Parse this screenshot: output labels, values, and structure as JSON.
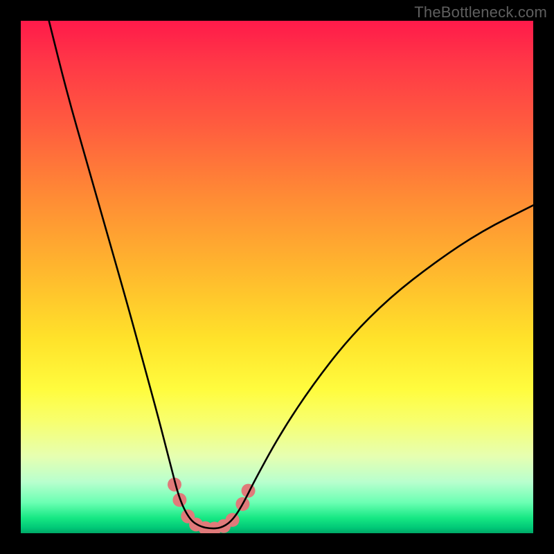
{
  "watermark": "TheBottleneck.com",
  "chart_data": {
    "type": "line",
    "title": "",
    "xlabel": "",
    "ylabel": "",
    "xlim": [
      0,
      100
    ],
    "ylim": [
      0,
      100
    ],
    "gradient_stops": [
      {
        "pct": 0,
        "color": "#ff1a4a"
      },
      {
        "pct": 8,
        "color": "#ff3747"
      },
      {
        "pct": 20,
        "color": "#ff5b3f"
      },
      {
        "pct": 34,
        "color": "#ff8a35"
      },
      {
        "pct": 48,
        "color": "#ffb52e"
      },
      {
        "pct": 62,
        "color": "#ffe22a"
      },
      {
        "pct": 72,
        "color": "#fffc3e"
      },
      {
        "pct": 78,
        "color": "#f8ff6d"
      },
      {
        "pct": 85,
        "color": "#e6ffb1"
      },
      {
        "pct": 90,
        "color": "#b8ffce"
      },
      {
        "pct": 94,
        "color": "#6bffb3"
      },
      {
        "pct": 97,
        "color": "#17e884"
      },
      {
        "pct": 99,
        "color": "#00c776"
      },
      {
        "pct": 100,
        "color": "#00a866"
      }
    ],
    "series": [
      {
        "name": "bottleneck-curve",
        "color": "#000000",
        "points": [
          {
            "x": 5.5,
            "y": 100
          },
          {
            "x": 9,
            "y": 86
          },
          {
            "x": 13,
            "y": 72
          },
          {
            "x": 17,
            "y": 58
          },
          {
            "x": 21,
            "y": 44
          },
          {
            "x": 24,
            "y": 33
          },
          {
            "x": 27,
            "y": 22
          },
          {
            "x": 29.3,
            "y": 13
          },
          {
            "x": 31,
            "y": 6.5
          },
          {
            "x": 33,
            "y": 2.6
          },
          {
            "x": 35,
            "y": 1.3
          },
          {
            "x": 37,
            "y": 0.9
          },
          {
            "x": 39,
            "y": 1.0
          },
          {
            "x": 41,
            "y": 2.2
          },
          {
            "x": 43,
            "y": 5.0
          },
          {
            "x": 46,
            "y": 11
          },
          {
            "x": 51,
            "y": 20
          },
          {
            "x": 57,
            "y": 29
          },
          {
            "x": 64,
            "y": 38
          },
          {
            "x": 72,
            "y": 46
          },
          {
            "x": 81,
            "y": 53
          },
          {
            "x": 90,
            "y": 59
          },
          {
            "x": 100,
            "y": 64
          }
        ]
      }
    ],
    "markers": {
      "color": "#e07a7a",
      "radius_px": 10,
      "points": [
        {
          "x": 30.0,
          "y": 9.5
        },
        {
          "x": 31.0,
          "y": 6.5
        },
        {
          "x": 32.6,
          "y": 3.3
        },
        {
          "x": 34.2,
          "y": 1.7
        },
        {
          "x": 36.0,
          "y": 1.0
        },
        {
          "x": 37.8,
          "y": 0.9
        },
        {
          "x": 39.6,
          "y": 1.4
        },
        {
          "x": 41.3,
          "y": 2.6
        },
        {
          "x": 43.3,
          "y": 5.7
        },
        {
          "x": 44.4,
          "y": 8.3
        }
      ]
    }
  }
}
